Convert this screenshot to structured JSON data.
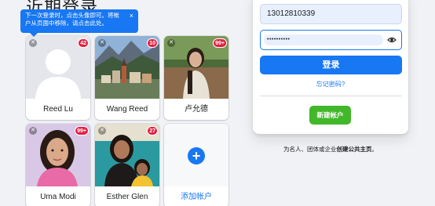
{
  "heading": "近期登录",
  "tooltip": {
    "text": "下一次登录时，点击头像即可。将帐户从页面中移除，请点击此处。",
    "close": "×"
  },
  "accounts": [
    {
      "name": "Reed Lu",
      "badge": "42"
    },
    {
      "name": "Wang Reed",
      "badge": "10"
    },
    {
      "name": "卢允德",
      "badge": "99+"
    },
    {
      "name": "Uma Modi",
      "badge": "99+"
    },
    {
      "name": "Esther Glen",
      "badge": "27"
    }
  ],
  "add_account": {
    "label": "添加帐户",
    "icon": "plus-icon"
  },
  "login": {
    "phone_value": "13012810339",
    "password_value": "••••••••••",
    "login_label": "登录",
    "forgot_label": "忘记密码?",
    "create_label": "新建帐户"
  },
  "page_text_before": "为名人、团体或企业",
  "page_text_bold": "创建公共主页",
  "page_text_after": "。",
  "colors": {
    "primary": "#1877f2",
    "success": "#42b72a",
    "badge": "#e41e3f",
    "background": "#f0f2f5"
  }
}
